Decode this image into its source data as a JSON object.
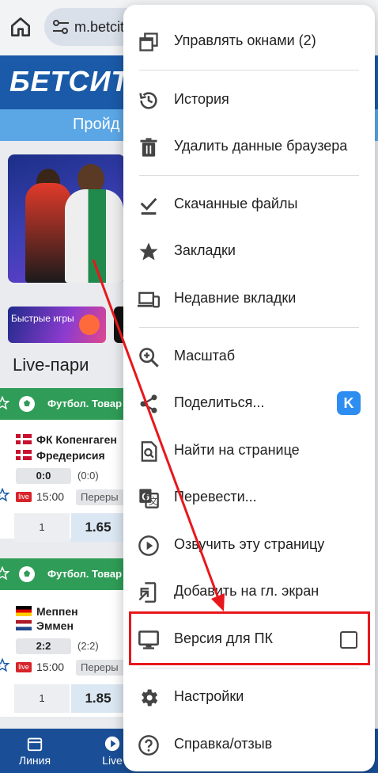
{
  "browser": {
    "url": "m.betcity",
    "home_icon": "home-icon",
    "site_settings_icon": "tune-icon"
  },
  "site": {
    "logo": "БЕТСИТИ",
    "promo_text": "Пройд",
    "games_card": "Быстрые игры",
    "live_title": "Live-пари",
    "matches": [
      {
        "league": "Футбол. Товар",
        "team1": "ФК Копенгаген",
        "team2": "Фредерисия",
        "score": "0:0",
        "half": "(0:0)",
        "live": "live",
        "time": "15:00",
        "status": "Переры",
        "odd_label": "1",
        "odd_value": "1.65"
      },
      {
        "league": "Футбол. Товар",
        "team1": "Меппен",
        "team2": "Эммен",
        "score": "2:2",
        "half": "(2:2)",
        "live": "live",
        "time": "15:00",
        "status": "Переры",
        "odd_label": "1",
        "odd_value": "1.85"
      }
    ],
    "nav": [
      {
        "label": "Линия",
        "icon": "calendar-icon"
      },
      {
        "label": "Live",
        "icon": "play-icon"
      }
    ]
  },
  "menu": {
    "items": [
      {
        "label": "Управлять окнами (2)",
        "icon": "windows-icon"
      },
      {
        "label": "История",
        "icon": "history-icon"
      },
      {
        "label": "Удалить данные браузера",
        "icon": "trash-icon"
      },
      {
        "label": "Скачанные файлы",
        "icon": "download-done-icon"
      },
      {
        "label": "Закладки",
        "icon": "star-icon"
      },
      {
        "label": "Недавние вкладки",
        "icon": "devices-icon"
      },
      {
        "label": "Масштаб",
        "icon": "zoom-in-icon"
      },
      {
        "label": "Поделиться...",
        "icon": "share-icon",
        "badge": "K"
      },
      {
        "label": "Найти на странице",
        "icon": "find-in-page-icon"
      },
      {
        "label": "Перевести...",
        "icon": "translate-icon"
      },
      {
        "label": "Озвучить эту страницу",
        "icon": "play-circle-icon"
      },
      {
        "label": "Добавить на гл. экран",
        "icon": "add-to-home-icon"
      },
      {
        "label": "Версия для ПК",
        "icon": "desktop-icon",
        "checked": false
      },
      {
        "label": "Настройки",
        "icon": "settings-icon"
      },
      {
        "label": "Справка/отзыв",
        "icon": "help-icon"
      }
    ]
  },
  "annotation": {
    "highlight_color": "#e8171c",
    "highlighted_item": "Версия для ПК"
  },
  "colors": {
    "site_blue": "#1a5aa8",
    "match_green": "#2f9d57",
    "live_red": "#d8232a"
  }
}
